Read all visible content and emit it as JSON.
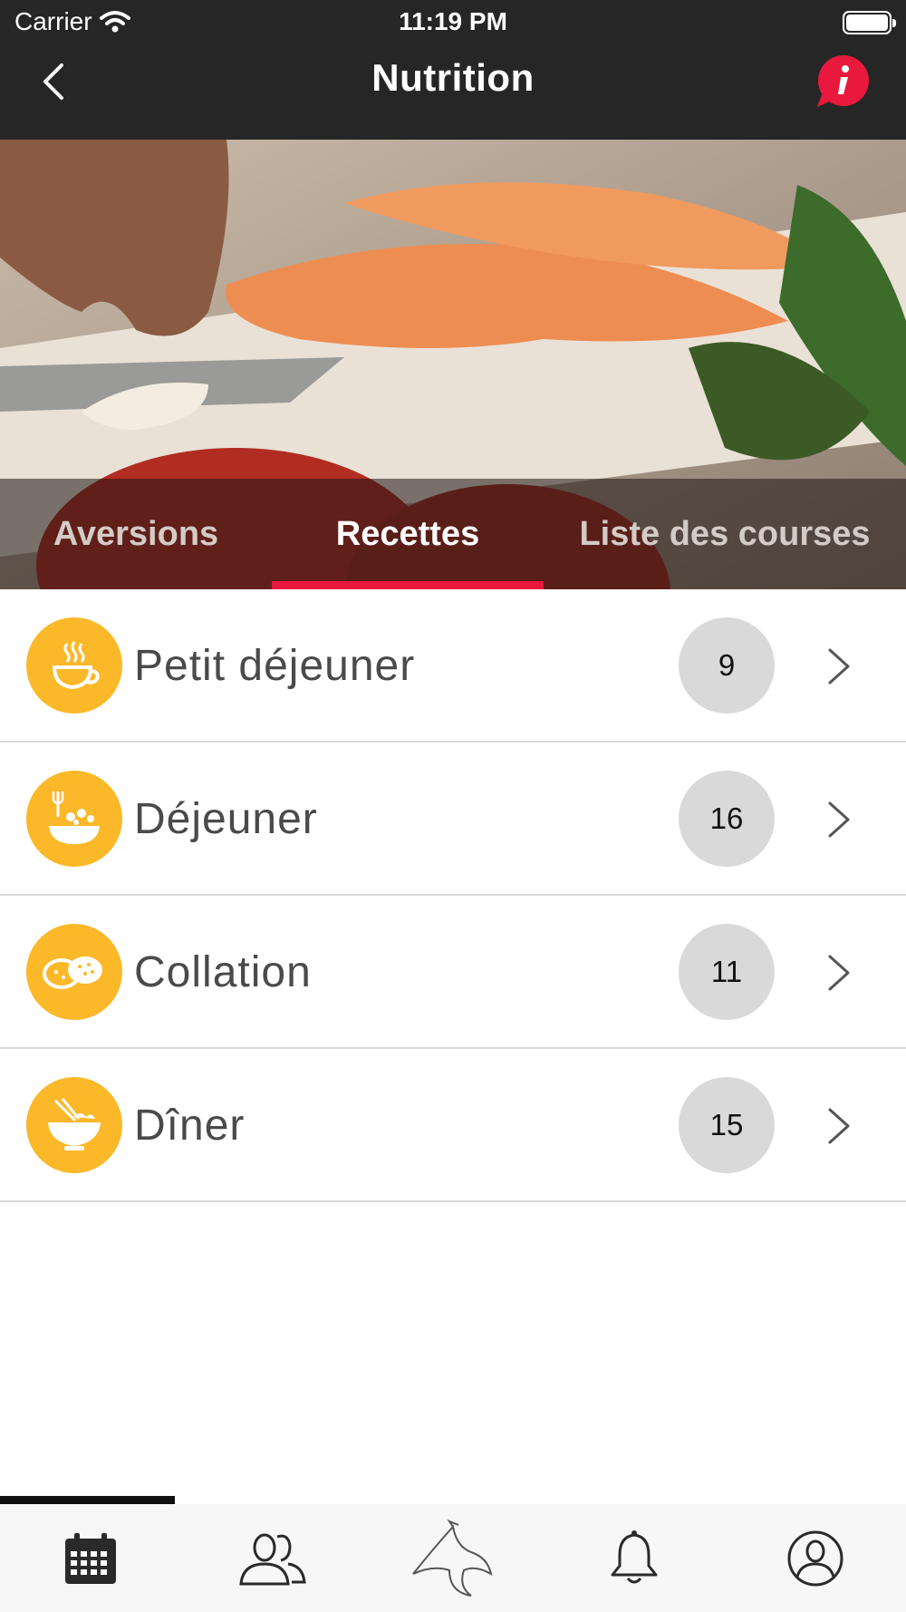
{
  "status_bar": {
    "carrier": "Carrier",
    "time": "11:19 PM"
  },
  "nav": {
    "title": "Nutrition",
    "back_icon": "chevron-left-icon",
    "info_icon": "info-icon",
    "info_color": "#e8193c"
  },
  "tabs": [
    {
      "label": "Aversions",
      "selected": false
    },
    {
      "label": "Recettes",
      "selected": true
    },
    {
      "label": "Liste des courses",
      "selected": false
    }
  ],
  "accent_color": "#e8193c",
  "icon_color": "#fbb829",
  "categories": [
    {
      "label": "Petit déjeuner",
      "count": "9",
      "icon": "coffee-cup-icon"
    },
    {
      "label": "Déjeuner",
      "count": "16",
      "icon": "salad-bowl-icon"
    },
    {
      "label": "Collation",
      "count": "11",
      "icon": "cookies-icon"
    },
    {
      "label": "Dîner",
      "count": "15",
      "icon": "chopsticks-bowl-icon"
    }
  ],
  "bottom_nav": [
    {
      "name": "calendar-icon",
      "active": true
    },
    {
      "name": "community-icon",
      "active": false
    },
    {
      "name": "manta-ray-logo-icon",
      "active": false
    },
    {
      "name": "bell-icon",
      "active": false
    },
    {
      "name": "profile-icon",
      "active": false
    }
  ]
}
